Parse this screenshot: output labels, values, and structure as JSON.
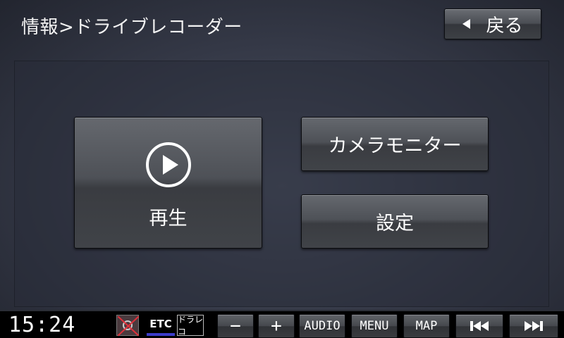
{
  "header": {
    "title": "情報>ドライブレコーダー",
    "back_label": "戻る"
  },
  "main": {
    "play_label": "再生",
    "camera_monitor_label": "カメラモニター",
    "settings_label": "設定"
  },
  "status_bar": {
    "clock": "15:24",
    "etc_label": "ETC",
    "drive_recorder_label": "ドラレコ",
    "buttons": {
      "volume_down": "−",
      "volume_up": "+",
      "audio": "AUDIO",
      "menu": "MENU",
      "map": "MAP"
    }
  },
  "icons": {
    "back": "triangle-left-icon",
    "play": "play-circle-icon",
    "camera_off": "camera-disabled-icon",
    "prev_track": "skip-previous-icon",
    "next_track": "skip-next-icon"
  }
}
